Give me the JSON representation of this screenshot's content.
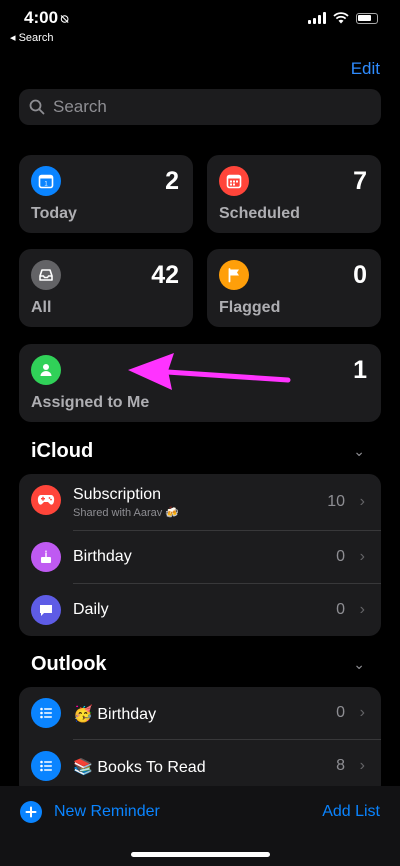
{
  "status": {
    "time": "4:00",
    "back_label": "◂ Search"
  },
  "header": {
    "edit_label": "Edit"
  },
  "search": {
    "placeholder": "Search"
  },
  "smart_lists": [
    {
      "label": "Today",
      "count": "2",
      "icon": "calendar-icon",
      "color": "#0a84ff"
    },
    {
      "label": "Scheduled",
      "count": "7",
      "icon": "calendar-grid-icon",
      "color": "#ff453a"
    },
    {
      "label": "All",
      "count": "42",
      "icon": "tray-icon",
      "color": "#636366"
    },
    {
      "label": "Flagged",
      "count": "0",
      "icon": "flag-icon",
      "color": "#ff9f0a"
    },
    {
      "label": "Assigned to Me",
      "count": "1",
      "icon": "person-icon",
      "color": "#30d158"
    }
  ],
  "annotation": {
    "arrow_color": "#ff33ff"
  },
  "icloud": {
    "title": "iCloud",
    "lists": [
      {
        "label": "Subscription",
        "subtitle": "Shared with Aarav 🍻",
        "count": "10",
        "icon": "gamecontroller-icon",
        "color": "#ff453a"
      },
      {
        "label": "Birthday",
        "count": "0",
        "icon": "cake-icon",
        "color": "#bf5af2"
      },
      {
        "label": "Daily",
        "count": "0",
        "icon": "message-bubble-icon",
        "color": "#5e5ce6"
      }
    ]
  },
  "outlook": {
    "title": "Outlook",
    "lists": [
      {
        "label": "🥳 Birthday",
        "count": "0",
        "icon": "list-bullet-icon",
        "color": "#0a84ff"
      },
      {
        "label": "📚 Books To Read",
        "count": "8",
        "icon": "list-bullet-icon",
        "color": "#0a84ff"
      }
    ]
  },
  "toolbar": {
    "new_reminder_label": "New Reminder",
    "add_list_label": "Add List",
    "accent": "#0a84ff"
  }
}
